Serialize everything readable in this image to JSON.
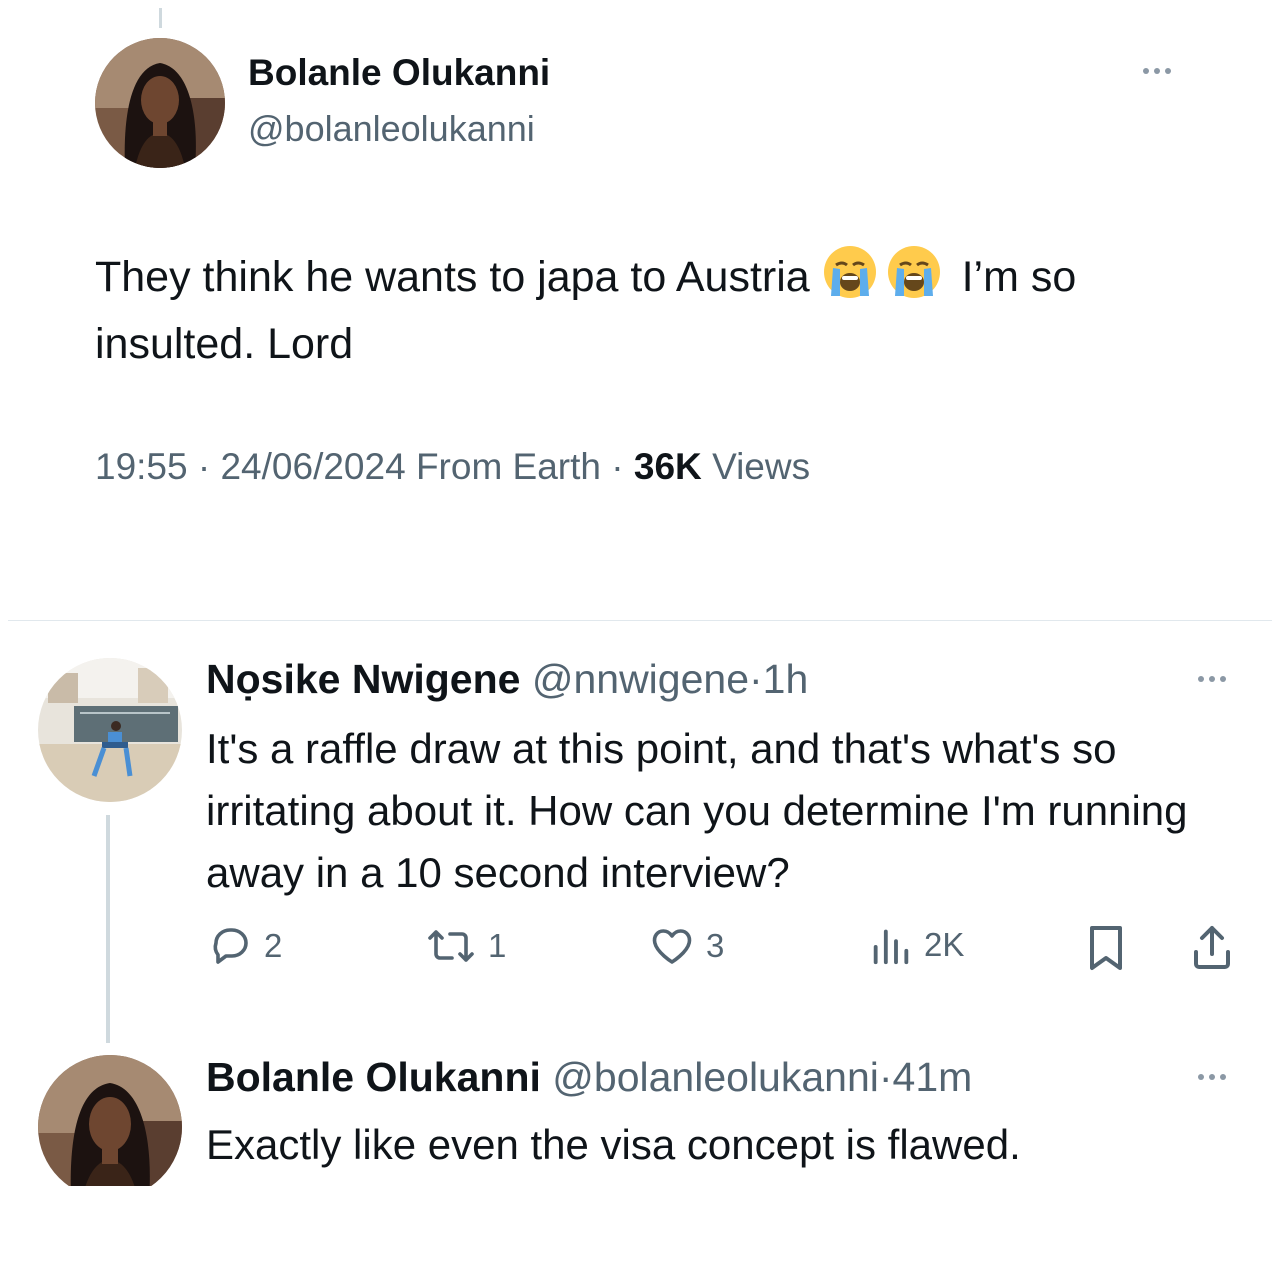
{
  "main_tweet": {
    "author_name": "Bolanle Olukanni",
    "author_handle": "@bolanleolukanni",
    "text_part1": "They think he wants to japa to Austria",
    "emojis": [
      "loudly-crying-face",
      "loudly-crying-face"
    ],
    "text_part2": "I’m so insulted. Lord",
    "time": "19:55",
    "date": "24/06/2024",
    "source": "From Earth",
    "views_count": "36K",
    "views_label": "Views",
    "separator": "·"
  },
  "replies": [
    {
      "author_name": "Nọsike Nwigene",
      "author_handle": "@nnwigene",
      "separator": "·",
      "time": "1h",
      "text": "It's a raffle draw at this point, and that's what's so irritating about it. How can you determine I'm running away in a 10 second interview?",
      "stats": {
        "replies": "2",
        "reposts": "1",
        "likes": "3",
        "views": "2K"
      }
    },
    {
      "author_name": "Bolanle Olukanni",
      "author_handle": "@bolanleolukanni",
      "separator": "·",
      "time": "41m",
      "text": "Exactly like even the visa concept is flawed."
    }
  ],
  "icons": [
    "more-icon",
    "reply-icon",
    "repost-icon",
    "like-icon",
    "views-icon",
    "bookmark-icon",
    "share-icon"
  ],
  "colors": {
    "text": "#0f1419",
    "secondary": "#536471",
    "divider": "#e1e8ed",
    "thread_line": "#cfd9de"
  }
}
